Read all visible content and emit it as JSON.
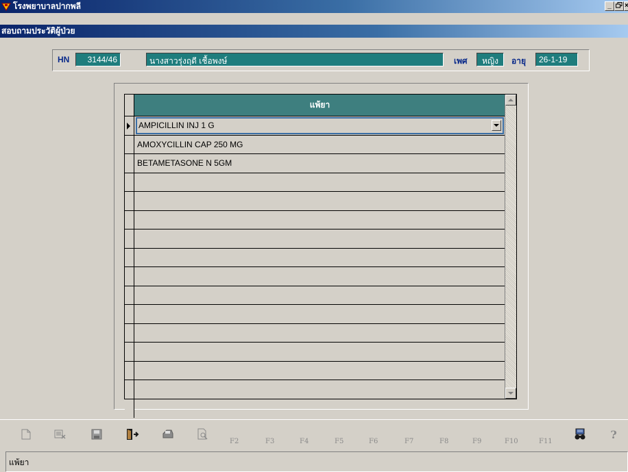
{
  "window": {
    "title": "โรงพยาบาลปากพลี",
    "minimize": "_",
    "maximize": "▫",
    "close": "×"
  },
  "form": {
    "title": "สอบถามประวัติผู้ป่วย"
  },
  "patient": {
    "hn_label": "HN",
    "hn_value": "3144/46",
    "name_value": "นางสาวรุ่งฤดี เชื้อพงษ์",
    "sex_label": "เพศ",
    "sex_value": "หญิง",
    "age_label": "อายุ",
    "age_value": "26-1-19"
  },
  "grid": {
    "column_header": "แพ้ยา",
    "rows": [
      "AMPICILLIN INJ 1 G",
      "AMOXYCILLIN CAP 250 MG",
      "BETAMETASONE N 5GM",
      "",
      "",
      "",
      "",
      "",
      "",
      "",
      "",
      "",
      "",
      "",
      "",
      ""
    ]
  },
  "toolbar": {
    "fkeys": [
      "F2",
      "F3",
      "F4",
      "F5",
      "F6",
      "F7",
      "F8",
      "F9",
      "F10",
      "F11"
    ],
    "icons": [
      "new-icon",
      "delete-icon",
      "save-icon",
      "exit-icon",
      "print-icon",
      "preview-icon",
      "search-binoculars-icon",
      "help-icon"
    ]
  },
  "status": {
    "text": "แพ้ยา"
  }
}
